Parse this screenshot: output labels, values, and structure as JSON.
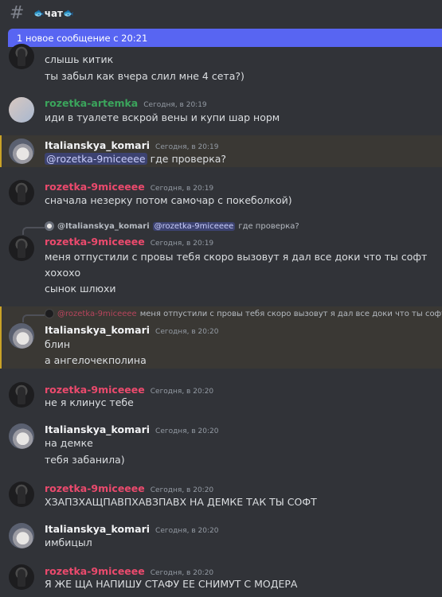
{
  "channel": {
    "name": "чат",
    "left_icon": "fish",
    "right_icon": "fish"
  },
  "new_messages_bar": "1 новое сообщение с 20:21",
  "messages": [
    {
      "author": "",
      "time": "",
      "lines": [
        "слышь китик",
        "ты забыл как вчера слил мне 4 сета?)"
      ]
    },
    {
      "author": "rozetka-artemka",
      "time": "Сегодня, в 20:19",
      "lines": [
        "иди в туалете вскрой вены и купи шар норм"
      ]
    },
    {
      "author": "Italianskya_komari",
      "time": "Сегодня, в 20:19",
      "mention": "@rozetka-9miceeee",
      "lines": [
        "где проверка?"
      ]
    },
    {
      "author": "rozetka-9miceeee",
      "time": "Сегодня, в 20:19",
      "lines": [
        "сначала незерку потом самочар с покеболкой)"
      ]
    },
    {
      "author": "rozetka-9miceeee",
      "time": "Сегодня, в 20:19",
      "reply": {
        "author": "@Italianskya_komari",
        "mention": "@rozetka-9miceeee",
        "text": "где проверка?"
      },
      "lines": [
        "меня отпустили с провы тебя скоро вызовут я дал все доки что ты софт",
        "хохохо",
        "сынок шлюхи"
      ]
    },
    {
      "author": "Italianskya_komari",
      "time": "Сегодня, в 20:20",
      "reply": {
        "author": "@rozetka-9miceeee",
        "text": "меня отпустили с провы тебя скоро вызовут я дал все доки что ты софт"
      },
      "lines": [
        "блин",
        "а ангелочекполина"
      ]
    },
    {
      "author": "rozetka-9miceeee",
      "time": "Сегодня, в 20:20",
      "lines": [
        "не я клинус тебе"
      ]
    },
    {
      "author": "Italianskya_komari",
      "time": "Сегодня, в 20:20",
      "lines": [
        "на демке",
        "тебя забанила)"
      ]
    },
    {
      "author": "rozetka-9miceeee",
      "time": "Сегодня, в 20:20",
      "lines": [
        "ХЗАПЗХАЩПАВПХАВЗПАВХ НА ДЕМКЕ ТАК ТЫ СОФТ"
      ]
    },
    {
      "author": "Italianskya_komari",
      "time": "Сегодня, в 20:20",
      "lines": [
        "имбицыл"
      ]
    },
    {
      "author": "rozetka-9miceeee",
      "time": "Сегодня, в 20:20",
      "lines": [
        "Я ЖЕ ЩА НАПИШУ СТАФУ ЕЕ СНИМУТ С МОДЕРА"
      ]
    }
  ],
  "colors": {
    "background": "#313338",
    "accent": "#5865f2",
    "red_name": "#eb4a6d",
    "green_name": "#3ba55c",
    "highlight": "#3a3834"
  }
}
